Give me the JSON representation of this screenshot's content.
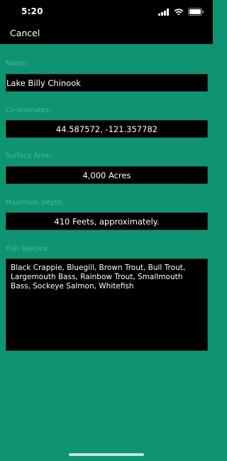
{
  "status_bar": {
    "time": "5:20",
    "icons": [
      "signal-icon",
      "wifi-icon",
      "battery-icon"
    ]
  },
  "nav": {
    "cancel_label": "Cancel"
  },
  "fields": {
    "name": {
      "label": "Name:",
      "value": "Lake Billy Chinook"
    },
    "coordinates": {
      "label": "Co-ordinates:",
      "value": "44.587572, -121.357782"
    },
    "surface_area": {
      "label": "Surface Area:",
      "value": "4,000 Acres"
    },
    "max_depth": {
      "label": "Maximum Depth:",
      "value": "410 Feets, approximately."
    },
    "fish_species": {
      "label": "Fish Species:",
      "value": "Black Crappie, Bluegill, Brown Trout, Bull Trout, Largemouth Bass, Rainbow Trout, Smallmouth Bass, Sockeye Salmon, Whitefish"
    }
  },
  "colors": {
    "background": "#0f9473",
    "label": "#48b99c",
    "field": "#000000",
    "text": "#ffffff"
  }
}
